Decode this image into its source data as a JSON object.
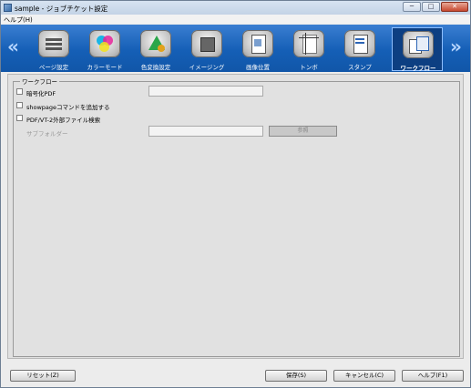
{
  "window": {
    "title": "sample - ジョブチケット設定",
    "minimize_glyph": "─",
    "maximize_glyph": "□",
    "close_glyph": "✕"
  },
  "menu": {
    "help": "ヘルプ(H)"
  },
  "toolbar": {
    "prev_arrow": "«",
    "next_arrow": "»",
    "tabs": [
      {
        "label": "ページ設定",
        "icon": "page-setup-icon"
      },
      {
        "label": "カラーモード",
        "icon": "color-mode-icon"
      },
      {
        "label": "色変換設定",
        "icon": "color-conversion-icon"
      },
      {
        "label": "イメージング",
        "icon": "imaging-icon"
      },
      {
        "label": "画像位置",
        "icon": "image-position-icon"
      },
      {
        "label": "トンボ",
        "icon": "crop-marks-icon"
      },
      {
        "label": "スタンプ",
        "icon": "stamp-icon"
      },
      {
        "label": "ワークフロー",
        "icon": "workflow-icon",
        "active": true
      }
    ]
  },
  "workflow": {
    "group_title": "ワークフロー",
    "encrypted_pdf": {
      "label": "暗号化PDF",
      "checked": false,
      "value": ""
    },
    "showpage": {
      "label": "showpageコマンドを追加する",
      "checked": false
    },
    "pdfvt": {
      "label": "PDF/VT-2外部ファイル検索",
      "checked": false
    },
    "subfolder": {
      "label": "サブフォルダー",
      "value": "",
      "browse_label": "参照"
    }
  },
  "footer": {
    "reset": "リセット(Z)",
    "save": "保存(S)",
    "cancel": "キャンセル(C)",
    "help": "ヘルプ(F1)"
  },
  "colors": {
    "toolbar": "#1a62b8",
    "active_tab": "#0d3f82"
  }
}
